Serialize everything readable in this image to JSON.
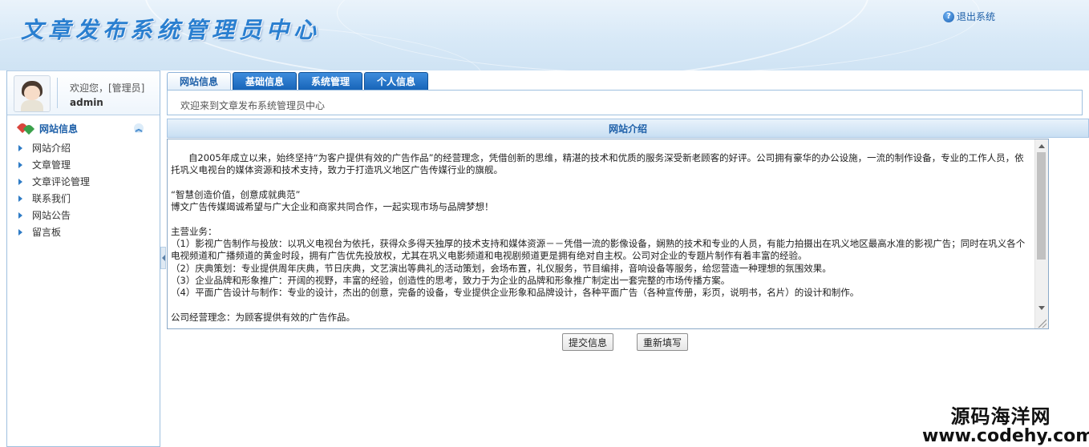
{
  "header": {
    "title": "文章发布系统管理员中心",
    "logout_label": "退出系统"
  },
  "user": {
    "welcome": "欢迎您，[管理员]",
    "name": "admin"
  },
  "sidebar": {
    "group_label": "网站信息",
    "items": [
      {
        "label": "网站介绍"
      },
      {
        "label": "文章管理"
      },
      {
        "label": "文章评论管理"
      },
      {
        "label": "联系我们"
      },
      {
        "label": "网站公告"
      },
      {
        "label": "留言板"
      }
    ]
  },
  "tabs": [
    {
      "label": "网站信息",
      "active": true
    },
    {
      "label": "基础信息",
      "active": false
    },
    {
      "label": "系统管理",
      "active": false
    },
    {
      "label": "个人信息",
      "active": false
    }
  ],
  "welcome_bar": "欢迎来到文章发布系统管理员中心",
  "section_title": "网站介绍",
  "content_text": "      自2005年成立以来，始终坚持“为客户提供有效的广告作品”的经营理念，凭借创新的思维，精湛的技术和优质的服务深受新老顾客的好评。公司拥有豪华的办公设施，一流的制作设备，专业的工作人员，依托巩义电视台的媒体资源和技术支持，致力于打造巩义地区广告传媒行业的旗舰。\n\n“智慧创造价值，创意成就典范”\n博文广告传媒竭诚希望与广大企业和商家共同合作，一起实现市场与品牌梦想！\n\n主营业务：\n（1）影视广告制作与投放：以巩义电视台为依托，获得众多得天独厚的技术支持和媒体资源－－凭借一流的影像设备，娴熟的技术和专业的人员，有能力拍摄出在巩义地区最高水准的影视广告；同时在巩义各个电视频道和广播频道的黄金时段，拥有广告优先投放权，尤其在巩义电影频道和电视剧频道更是拥有绝对自主权。公司对企业的专题片制作有着丰富的经验。\n（2）庆典策划：专业提供周年庆典，节日庆典，文艺演出等典礼的活动策划，会场布置，礼仪服务，节目编排，音响设备等服务，给您营造一种理想的氛围效果。\n（3）企业品牌和形象推广：开阔的视野，丰富的经验，创造性的思考，致力于为企业的品牌和形象推广制定出一套完整的市场传播方案。\n（4）平面广告设计与制作：专业的设计，杰出的创意，完备的设备，专业提供企业形象和品牌设计，各种平面广告（各种宣传册，彩页，说明书，名片）的设计和制作。\n\n公司经营理念：为顾客提供有效的广告作品。",
  "buttons": {
    "submit": "提交信息",
    "reset": "重新填写"
  },
  "watermark": {
    "line1": "源码海洋网",
    "line2": "www.codehy.com"
  },
  "colors": {
    "accent": "#1d5fa8",
    "tab_active_bg": "#e4effa",
    "tab_bg": "#1764b8",
    "header_bg": "#d8e9f7"
  },
  "icons": {
    "logout": "help-question-icon",
    "menu_group": "hearts-icon",
    "collapse": "double-chevron-up-icon",
    "menu_item": "triangle-right-icon"
  }
}
